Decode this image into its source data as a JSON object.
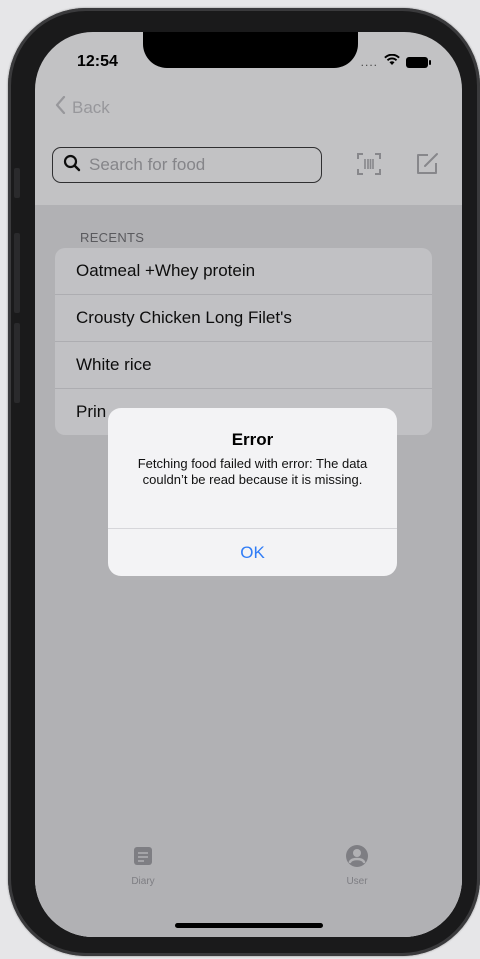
{
  "status_bar": {
    "time": "12:54",
    "carrier": "....",
    "wifi_icon": "wifi-icon",
    "battery_icon": "battery-icon"
  },
  "nav": {
    "back_label": "Back",
    "back_icon": "chevron-left-icon"
  },
  "search": {
    "placeholder": "Search for food",
    "value": ""
  },
  "toolbar": {
    "scan_icon": "barcode-scan-icon",
    "compose_icon": "compose-icon"
  },
  "recents": {
    "header": "RECENTS",
    "items": [
      {
        "label": "Oatmeal +Whey protein"
      },
      {
        "label": "Crousty Chicken Long Filet's"
      },
      {
        "label": "White rice"
      },
      {
        "label": "Prin"
      }
    ]
  },
  "alert": {
    "title": "Error",
    "message": "Fetching food failed with error: The data couldn’t be read because it is missing.",
    "ok_label": "OK"
  },
  "tabs": [
    {
      "label": "Diary",
      "icon": "diary-icon"
    },
    {
      "label": "User",
      "icon": "user-icon"
    }
  ],
  "colors": {
    "accent": "#2f7cf6",
    "list_bg": "#ececef",
    "content_bg": "#d8d8dc"
  }
}
